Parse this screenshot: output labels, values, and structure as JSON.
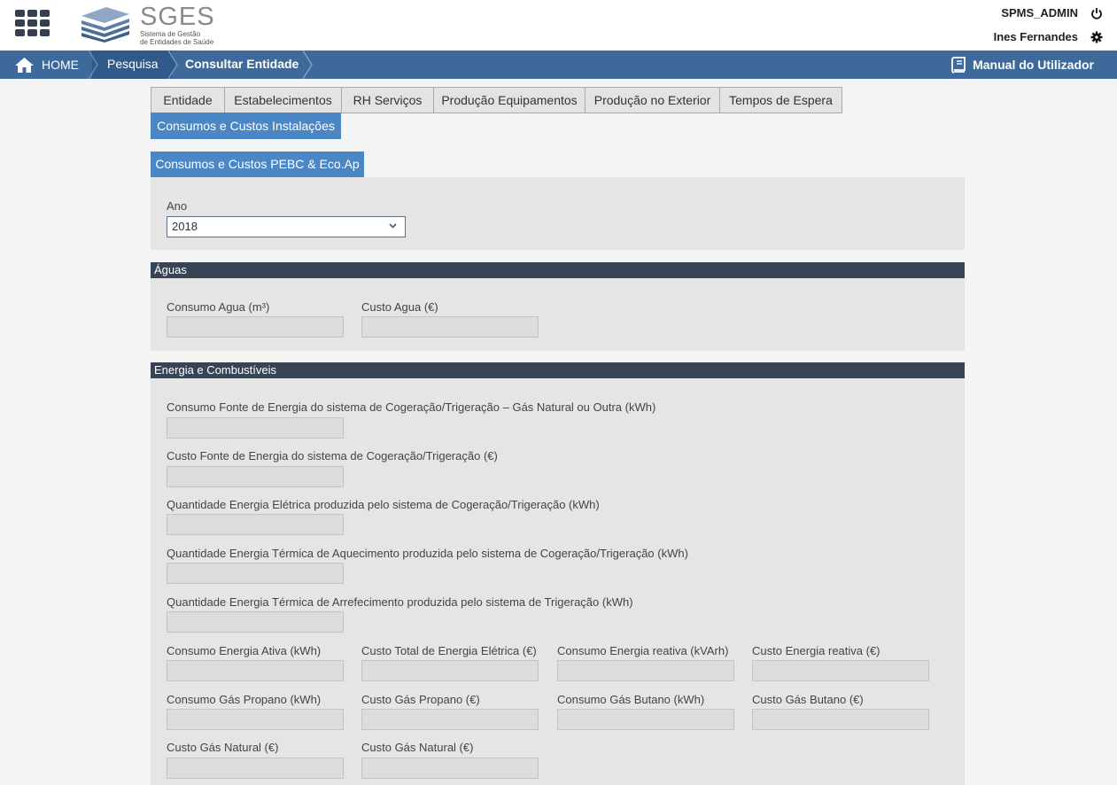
{
  "header": {
    "logo_title": "SGES",
    "logo_sub_line1": "Sistema de Gestão",
    "logo_sub_line2": "de Entidades de Saúde",
    "user_role": "SPMS_ADMIN",
    "user_name": "Ines Fernandes"
  },
  "navbar": {
    "home": "HOME",
    "pesquisa": "Pesquisa",
    "consultar": "Consultar Entidade",
    "manual": "Manual do Utilizador"
  },
  "tabs": [
    {
      "label": "Entidade"
    },
    {
      "label": "Estabelecimentos"
    },
    {
      "label": "RH Serviços"
    },
    {
      "label": "Produção Equipamentos"
    },
    {
      "label": "Produção no Exterior"
    },
    {
      "label": "Tempos de Espera"
    },
    {
      "label": "Consumos e Custos Instalações"
    }
  ],
  "subtab": {
    "label": "Consumos e Custos PEBC & Eco.Ap"
  },
  "ano": {
    "label": "Ano",
    "value": "2018"
  },
  "aguas": {
    "title": "Águas",
    "fields": [
      {
        "label": "Consumo Agua (m³)",
        "value": ""
      },
      {
        "label": "Custo Agua (€)",
        "value": ""
      }
    ]
  },
  "energia": {
    "title": "Energia e Combustíveis",
    "wide_fields": [
      {
        "label": "Consumo Fonte de Energia do sistema de Cogeração/Trigeração – Gás Natural ou Outra (kWh)",
        "value": ""
      },
      {
        "label": "Custo Fonte de Energia do sistema de Cogeração/Trigeração (€)",
        "value": ""
      },
      {
        "label": "Quantidade Energia Elétrica produzida pelo sistema de Cogeração/Trigeração (kWh)",
        "value": ""
      },
      {
        "label": "Quantidade Energia Térmica de Aquecimento produzida pelo sistema de Cogeração/Trigeração (kWh)",
        "value": ""
      },
      {
        "label": "Quantidade Energia Térmica de Arrefecimento produzida pelo sistema de Trigeração (kWh)",
        "value": ""
      }
    ],
    "grid_fields": [
      {
        "label": "Consumo Energia Ativa (kWh)",
        "value": ""
      },
      {
        "label": "Custo Total de Energia Elétrica (€)",
        "value": ""
      },
      {
        "label": "Consumo Energia reativa (kVArh)",
        "value": ""
      },
      {
        "label": "Custo Energia reativa (€)",
        "value": ""
      },
      {
        "label": "Consumo Gás Propano (kWh)",
        "value": ""
      },
      {
        "label": "Custo Gás Propano (€)",
        "value": ""
      },
      {
        "label": "Consumo Gás Butano (kWh)",
        "value": ""
      },
      {
        "label": "Custo Gás Butano (€)",
        "value": ""
      },
      {
        "label": "Custo Gás Natural (€)",
        "value": ""
      },
      {
        "label": "Custo Gás Natural (€)",
        "value": ""
      }
    ]
  },
  "colors": {
    "navbar": "#3d6a9a",
    "active_tab": "#4b86c5",
    "section_bar": "#374453"
  }
}
